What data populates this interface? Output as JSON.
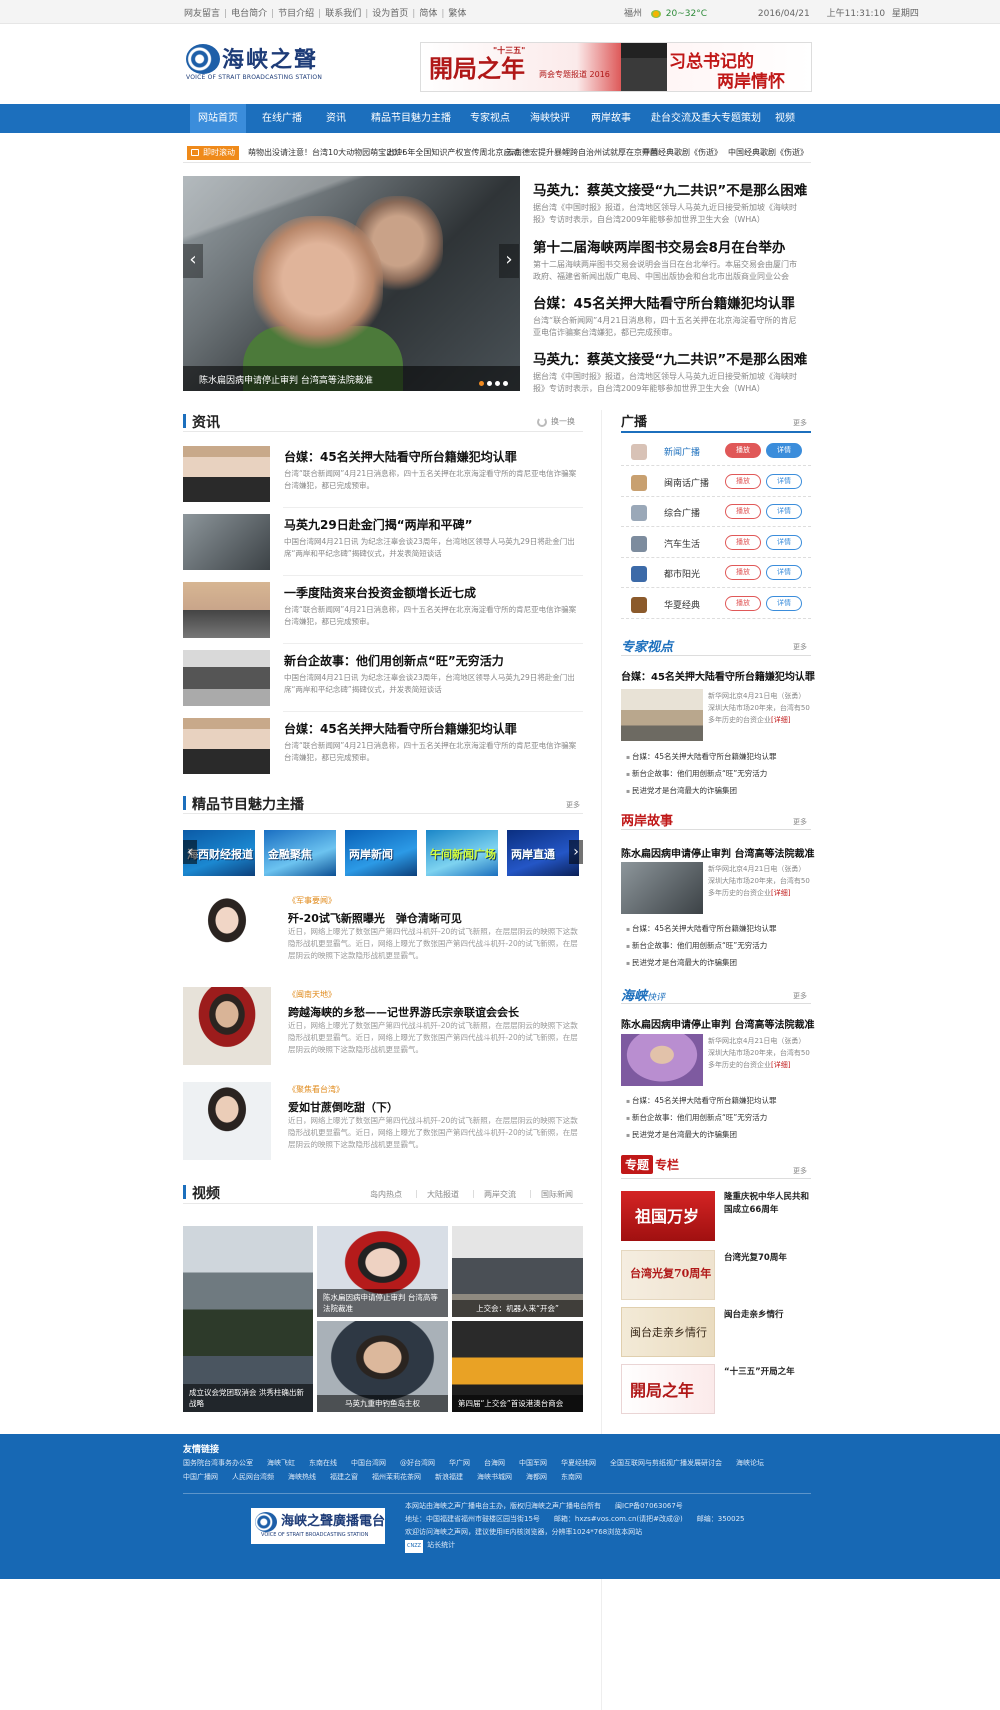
{
  "topbar": {
    "links": [
      "网友留言",
      "电台简介",
      "节目介绍",
      "联系我们",
      "设为首页",
      "简体",
      "繁体"
    ],
    "separator": "|",
    "city": "福州",
    "weather": "20~32°C",
    "date": "2016/04/21",
    "time": "上午11:31:10",
    "weekday": "星期四"
  },
  "logo": {
    "cn": "海峡之聲",
    "en": "VOICE OF STRAIT BROADCASTING STATION"
  },
  "banner": {
    "main": "開局之年",
    "tag": "\"十三五\"",
    "sub": "两会专题报道 2016",
    "right_a": "习总书记的",
    "right_b": "两岸情怀"
  },
  "nav": {
    "items": [
      "网站首页",
      "在线广播",
      "资讯",
      "精品节目魅力主播",
      "专家视点",
      "海峡快评",
      "两岸故事",
      "赴台交流及重大专题策划",
      "视频"
    ]
  },
  "ticker": {
    "badge": "即时滚动",
    "items": [
      "萌物出没请注意！台湾10大动物园萌宝出炉!",
      "2016年全国知识产权宣传周北京启动",
      "云南德宏提升暴鲤跨自治州试就厚在京开幕",
      "中国经典歌剧《伤逝》",
      "中国经典歌剧《伤逝》"
    ]
  },
  "slideshow": {
    "caption": "陈水扁因病申请停止审判 台湾高等法院裁准",
    "prev": "‹",
    "next": "›"
  },
  "headlines": [
    {
      "title": "马英九：蔡英文接受“九二共识”不是那么困难",
      "desc": "据台湾《中国时报》报道，台湾地区领导人马英九近日接受新加坡《海峡时报》专访时表示，自台湾2009年能够参加世界卫生大会（WHA）"
    },
    {
      "title": "第十二届海峡两岸图书交易会8月在台举办",
      "desc": "第十二届海峡两岸图书交易会说明会当日在台北举行。本届交易会由厦门市政府、福建省新闻出版广电局、中国出版协会和台北市出版商业同业公会"
    },
    {
      "title": "台媒：45名关押大陆看守所台籍嫌犯均认罪",
      "desc": "台湾“联合新闻网”4月21日消息称，四十五名关押在北京海淀看守所的肯尼亚电信诈骗案台湾嫌犯，都已完成预审。"
    },
    {
      "title": "马英九：蔡英文接受“九二共识”不是那么困难",
      "desc": "据台湾《中国时报》报道，台湾地区领导人马英九近日接受新加坡《海峡时报》专访时表示，自台湾2009年能够参加世界卫生大会（WHA）"
    }
  ],
  "news": {
    "title": "资讯",
    "refresh": "换一换",
    "items": [
      {
        "title": "台媒：45名关押大陆看守所台籍嫌犯均认罪",
        "desc": "台湾“联合新闻网”4月21日消息称，四十五名关押在北京海淀看守所的肯尼亚电信诈骗案台湾嫌犯，都已完成预审。"
      },
      {
        "title": "马英九29日赴金门揭“两岸和平碑”",
        "desc": "中国台湾网4月21日讯 为纪念汪辜会谈23周年，台湾地区领导人马英九29日将赴金门出席“两岸和平纪念碑”揭碑仪式，并发表简短谈话"
      },
      {
        "title": "一季度陆资来台投资金额增长近七成",
        "desc": "台湾“联合新闻网”4月21日消息称，四十五名关押在北京海淀看守所的肯尼亚电信诈骗案台湾嫌犯，都已完成预审。"
      },
      {
        "title": "新台企故事：他们用创新点“旺”无穷活力",
        "desc": "中国台湾网4月21日讯 为纪念汪辜会谈23周年，台湾地区领导人马英九29日将赴金门出席“两岸和平纪念碑”揭碑仪式，并发表简短谈话"
      },
      {
        "title": "台媒：45名关押大陆看守所台籍嫌犯均认罪",
        "desc": "台湾“联合新闻网”4月21日消息称，四十五名关押在北京海淀看守所的肯尼亚电信诈骗案台湾嫌犯，都已完成预审。"
      }
    ]
  },
  "programs": {
    "title": "精品节目魅力主播",
    "more": "更多",
    "carousel": [
      "海西财经报道",
      "金融聚焦",
      "两岸新闻",
      "午间新闻广场",
      "两岸直通"
    ],
    "anchors": [
      {
        "tag": "《军事要闻》",
        "title": "歼-20试飞新照曝光　弹仓清晰可见",
        "desc": "近日，网络上曝光了数张国产第四代战斗机歼-20的试飞新照，在层层阴云的映照下这款隐形战机更显霸气。近日，网络上曝光了数张国产第四代战斗机歼-20的试飞新照，在层层阴云的映照下这款隐形战机更显霸气。"
      },
      {
        "tag": "《闽南天地》",
        "title": "跨越海峡的乡愁——记世界游氏宗亲联谊会会长",
        "desc": "近日，网络上曝光了数张国产第四代战斗机歼-20的试飞新照，在层层阴云的映照下这款隐形战机更显霸气。近日，网络上曝光了数张国产第四代战斗机歼-20的试飞新照，在层层阴云的映照下这款隐形战机更显霸气。"
      },
      {
        "tag": "《聚焦看台湾》",
        "title": "爱如甘蔗倒吃甜（下）",
        "desc": "近日，网络上曝光了数张国产第四代战斗机歼-20的试飞新照，在层层阴云的映照下这款隐形战机更显霸气。近日，网络上曝光了数张国产第四代战斗机歼-20的试飞新照，在层层阴云的映照下这款隐形战机更显霸气。"
      }
    ]
  },
  "video": {
    "title": "视频",
    "tabs": [
      "岛内热点",
      "大陆报道",
      "两岸交流",
      "国际新闻"
    ],
    "separator": "|",
    "cells": [
      {
        "caption": "成立议会党团取消会 洪秀柱确出新战略"
      },
      {
        "caption": "陈水扁因病申请停止审判 台湾高等法院裁准"
      },
      {
        "caption": "上交会：机器人来“开会”"
      },
      {
        "caption": "马英九重申钓鱼岛主权"
      },
      {
        "caption": "第四届“上交会”首设港澳台商会"
      }
    ]
  },
  "broadcast": {
    "title": "广播",
    "more": "更多",
    "play": "播放",
    "detail": "详情",
    "stations": [
      "新闻广播",
      "闽南话广播",
      "综合广播",
      "汽车生活",
      "都市阳光",
      "华夏经典"
    ],
    "icon_colors": [
      "#d8c2b6",
      "#c8a070",
      "#9aa8b8",
      "#7d8c9e",
      "#3c6aa8",
      "#8b5a2b"
    ]
  },
  "expert": {
    "title": "专家视点",
    "more": "更多",
    "headline": "台媒：45名关押大陆看守所台籍嫌犯均认罪",
    "desc": "新华网北京4月21日电（张勇）深圳大陆市场20年来，台湾有50多年历史的台资企业",
    "detail": "[详细]",
    "list": [
      "台媒：45名关押大陆看守所台籍嫌犯均认罪",
      "新台企故事：他们用创新点“旺”无穷活力",
      "民进党才是台湾最大的诈骗集团"
    ]
  },
  "story": {
    "title": "两岸故事",
    "more": "更多",
    "headline": "陈水扁因病申请停止审判 台湾高等法院裁准",
    "desc": "新华网北京4月21日电（张勇）深圳大陆市场20年来，台湾有50多年历史的台资企业",
    "detail": "[详细]",
    "list": [
      "台媒：45名关押大陆看守所台籍嫌犯均认罪",
      "新台企故事：他们用创新点“旺”无穷活力",
      "民进党才是台湾最大的诈骗集团"
    ]
  },
  "review": {
    "title_a": "海峡",
    "title_b": "快评",
    "more": "更多",
    "headline": "陈水扁因病申请停止审判 台湾高等法院裁准",
    "desc": "新华网北京4月21日电（张勇）深圳大陆市场20年来，台湾有50多年历史的台资企业",
    "detail": "[详细]",
    "list": [
      "台媒：45名关押大陆看守所台籍嫌犯均认罪",
      "新台企故事：他们用创新点“旺”无穷活力",
      "民进党才是台湾最大的诈骗集团"
    ]
  },
  "special": {
    "title_a": "专题",
    "title_b": "专栏",
    "more": "更多",
    "items": [
      {
        "img": "祖国万岁",
        "text": "隆重庆祝中华人民共和国成立66周年"
      },
      {
        "img": "台湾光复70周年",
        "text": "台湾光复70周年"
      },
      {
        "img": "闽台走亲乡情行",
        "text": "闽台走亲乡情行"
      },
      {
        "img": "開局之年",
        "text": "“十三五”开局之年"
      }
    ]
  },
  "footer": {
    "links_title": "友情链接",
    "links": [
      "国务院台湾事务办公室",
      "海峡飞虹",
      "东南在线",
      "中国台湾网",
      "@好台湾网",
      "华广网",
      "台海网",
      "中国军网",
      "华夏经纬网",
      "全国互联网与剪纸视广播发展研讨会",
      "海峡论坛",
      "中国广播网",
      "人民网台湾频",
      "海峡热线",
      "福建之窗",
      "福州茉莉花茶网",
      "新浪福建",
      "海峡书城网",
      "海都网",
      "东南网"
    ],
    "logo_cn": "海峡之聲廣播電台",
    "logo_en": "VOICE OF STRAIT BROADCASTING STATION",
    "info": [
      "本网站由海峡之声广播电台主办，版权归海峡之声广播电台所有　　闽ICP备07063067号",
      "地址：中国福建省福州市鼓楼区园当街15号　　邮箱：hxzs#vos.com.cn(请把#改成@)　　邮编：350025",
      "欢迎访问海峡之声网，建议使用IE内核浏览器，分辨率1024*768浏览本网站",
      "站长统计"
    ]
  }
}
